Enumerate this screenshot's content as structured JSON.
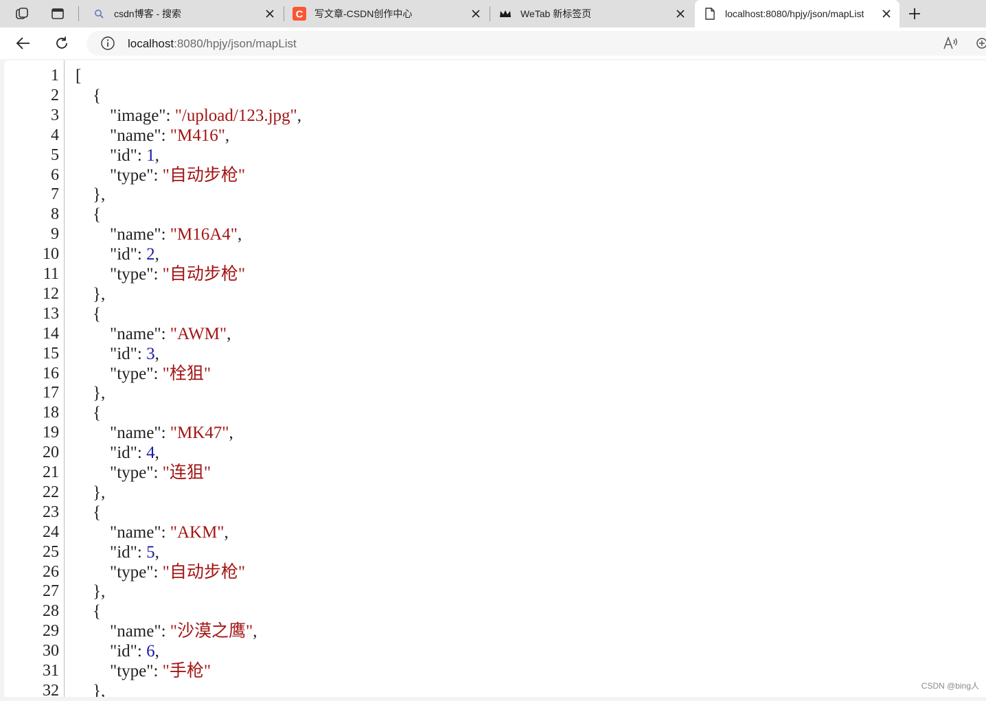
{
  "browser": {
    "tabs": [
      {
        "title": "csdn博客 - 搜索",
        "icon": "search-icon"
      },
      {
        "title": "写文章-CSDN创作中心",
        "icon": "csdn-logo-icon",
        "icon_color": "#fc5531"
      },
      {
        "title": "WeTab 新标签页",
        "icon": "wetab-crown-icon"
      },
      {
        "title": "localhost:8080/hpjy/json/mapList",
        "icon": "page-icon",
        "active": true
      }
    ],
    "url_host": "localhost",
    "url_rest": ":8080/hpjy/json/mapList"
  },
  "json_lines": [
    {
      "n": "1",
      "parts": [
        [
          "p",
          "["
        ]
      ]
    },
    {
      "n": "2",
      "parts": [
        [
          "p",
          "    {"
        ]
      ]
    },
    {
      "n": "3",
      "parts": [
        [
          "k",
          "        \"image\""
        ],
        [
          "p",
          ": "
        ],
        [
          "s",
          "\"/upload/123.jpg\""
        ],
        [
          "p",
          ","
        ]
      ]
    },
    {
      "n": "4",
      "parts": [
        [
          "k",
          "        \"name\""
        ],
        [
          "p",
          ": "
        ],
        [
          "s",
          "\"M416\""
        ],
        [
          "p",
          ","
        ]
      ]
    },
    {
      "n": "5",
      "parts": [
        [
          "k",
          "        \"id\""
        ],
        [
          "p",
          ": "
        ],
        [
          "n",
          "1"
        ],
        [
          "p",
          ","
        ]
      ]
    },
    {
      "n": "6",
      "parts": [
        [
          "k",
          "        \"type\""
        ],
        [
          "p",
          ": "
        ],
        [
          "s",
          "\"自动步枪\""
        ]
      ]
    },
    {
      "n": "7",
      "parts": [
        [
          "p",
          "    },"
        ]
      ]
    },
    {
      "n": "8",
      "parts": [
        [
          "p",
          "    {"
        ]
      ]
    },
    {
      "n": "9",
      "parts": [
        [
          "k",
          "        \"name\""
        ],
        [
          "p",
          ": "
        ],
        [
          "s",
          "\"M16A4\""
        ],
        [
          "p",
          ","
        ]
      ]
    },
    {
      "n": "10",
      "parts": [
        [
          "k",
          "        \"id\""
        ],
        [
          "p",
          ": "
        ],
        [
          "n",
          "2"
        ],
        [
          "p",
          ","
        ]
      ]
    },
    {
      "n": "11",
      "parts": [
        [
          "k",
          "        \"type\""
        ],
        [
          "p",
          ": "
        ],
        [
          "s",
          "\"自动步枪\""
        ]
      ]
    },
    {
      "n": "12",
      "parts": [
        [
          "p",
          "    },"
        ]
      ]
    },
    {
      "n": "13",
      "parts": [
        [
          "p",
          "    {"
        ]
      ]
    },
    {
      "n": "14",
      "parts": [
        [
          "k",
          "        \"name\""
        ],
        [
          "p",
          ": "
        ],
        [
          "s",
          "\"AWM\""
        ],
        [
          "p",
          ","
        ]
      ]
    },
    {
      "n": "15",
      "parts": [
        [
          "k",
          "        \"id\""
        ],
        [
          "p",
          ": "
        ],
        [
          "n",
          "3"
        ],
        [
          "p",
          ","
        ]
      ]
    },
    {
      "n": "16",
      "parts": [
        [
          "k",
          "        \"type\""
        ],
        [
          "p",
          ": "
        ],
        [
          "s",
          "\"栓狙\""
        ]
      ]
    },
    {
      "n": "17",
      "parts": [
        [
          "p",
          "    },"
        ]
      ]
    },
    {
      "n": "18",
      "parts": [
        [
          "p",
          "    {"
        ]
      ]
    },
    {
      "n": "19",
      "parts": [
        [
          "k",
          "        \"name\""
        ],
        [
          "p",
          ": "
        ],
        [
          "s",
          "\"MK47\""
        ],
        [
          "p",
          ","
        ]
      ]
    },
    {
      "n": "20",
      "parts": [
        [
          "k",
          "        \"id\""
        ],
        [
          "p",
          ": "
        ],
        [
          "n",
          "4"
        ],
        [
          "p",
          ","
        ]
      ]
    },
    {
      "n": "21",
      "parts": [
        [
          "k",
          "        \"type\""
        ],
        [
          "p",
          ": "
        ],
        [
          "s",
          "\"连狙\""
        ]
      ]
    },
    {
      "n": "22",
      "parts": [
        [
          "p",
          "    },"
        ]
      ]
    },
    {
      "n": "23",
      "parts": [
        [
          "p",
          "    {"
        ]
      ]
    },
    {
      "n": "24",
      "parts": [
        [
          "k",
          "        \"name\""
        ],
        [
          "p",
          ": "
        ],
        [
          "s",
          "\"AKM\""
        ],
        [
          "p",
          ","
        ]
      ]
    },
    {
      "n": "25",
      "parts": [
        [
          "k",
          "        \"id\""
        ],
        [
          "p",
          ": "
        ],
        [
          "n",
          "5"
        ],
        [
          "p",
          ","
        ]
      ]
    },
    {
      "n": "26",
      "parts": [
        [
          "k",
          "        \"type\""
        ],
        [
          "p",
          ": "
        ],
        [
          "s",
          "\"自动步枪\""
        ]
      ]
    },
    {
      "n": "27",
      "parts": [
        [
          "p",
          "    },"
        ]
      ]
    },
    {
      "n": "28",
      "parts": [
        [
          "p",
          "    {"
        ]
      ]
    },
    {
      "n": "29",
      "parts": [
        [
          "k",
          "        \"name\""
        ],
        [
          "p",
          ": "
        ],
        [
          "s",
          "\"沙漠之鹰\""
        ],
        [
          "p",
          ","
        ]
      ]
    },
    {
      "n": "30",
      "parts": [
        [
          "k",
          "        \"id\""
        ],
        [
          "p",
          ": "
        ],
        [
          "n",
          "6"
        ],
        [
          "p",
          ","
        ]
      ]
    },
    {
      "n": "31",
      "parts": [
        [
          "k",
          "        \"type\""
        ],
        [
          "p",
          ": "
        ],
        [
          "s",
          "\"手枪\""
        ]
      ]
    },
    {
      "n": "32",
      "parts": [
        [
          "p",
          "    },"
        ]
      ]
    }
  ],
  "colors": {
    "string": "#a31515",
    "number": "#1a1aa6",
    "key": "#222222"
  },
  "watermark": "CSDN @bing人"
}
